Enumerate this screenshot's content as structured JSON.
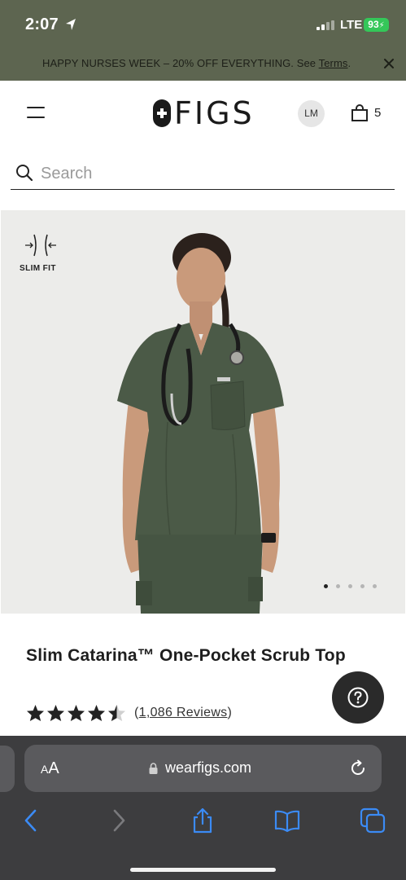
{
  "status_bar": {
    "time": "2:07",
    "network": "LTE",
    "battery": "93"
  },
  "promo": {
    "text": "HAPPY NURSES WEEK – 20% OFF EVERYTHING. See ",
    "link": "Terms",
    "suffix": "."
  },
  "header": {
    "logo": "FIGS",
    "avatar_initials": "LM",
    "cart_count": "5"
  },
  "search": {
    "placeholder": "Search"
  },
  "product": {
    "fit_label": "SLIM FIT",
    "carousel": {
      "total": 5,
      "active": 1
    },
    "title": "Slim Catarina™ One-Pocket Scrub Top",
    "rating": 4.5,
    "reviews_open": "(",
    "reviews_count": "1,086 Reviews",
    "reviews_close": ")"
  },
  "browser": {
    "aa_label": "AA",
    "url": "wearfigs.com"
  },
  "colors": {
    "promo_bg": "#5d6550",
    "scrub_green": "#4b5a47",
    "safari_bar": "#3d3d3f",
    "safari_blue": "#3b8bf5",
    "battery_green": "#34c759"
  }
}
